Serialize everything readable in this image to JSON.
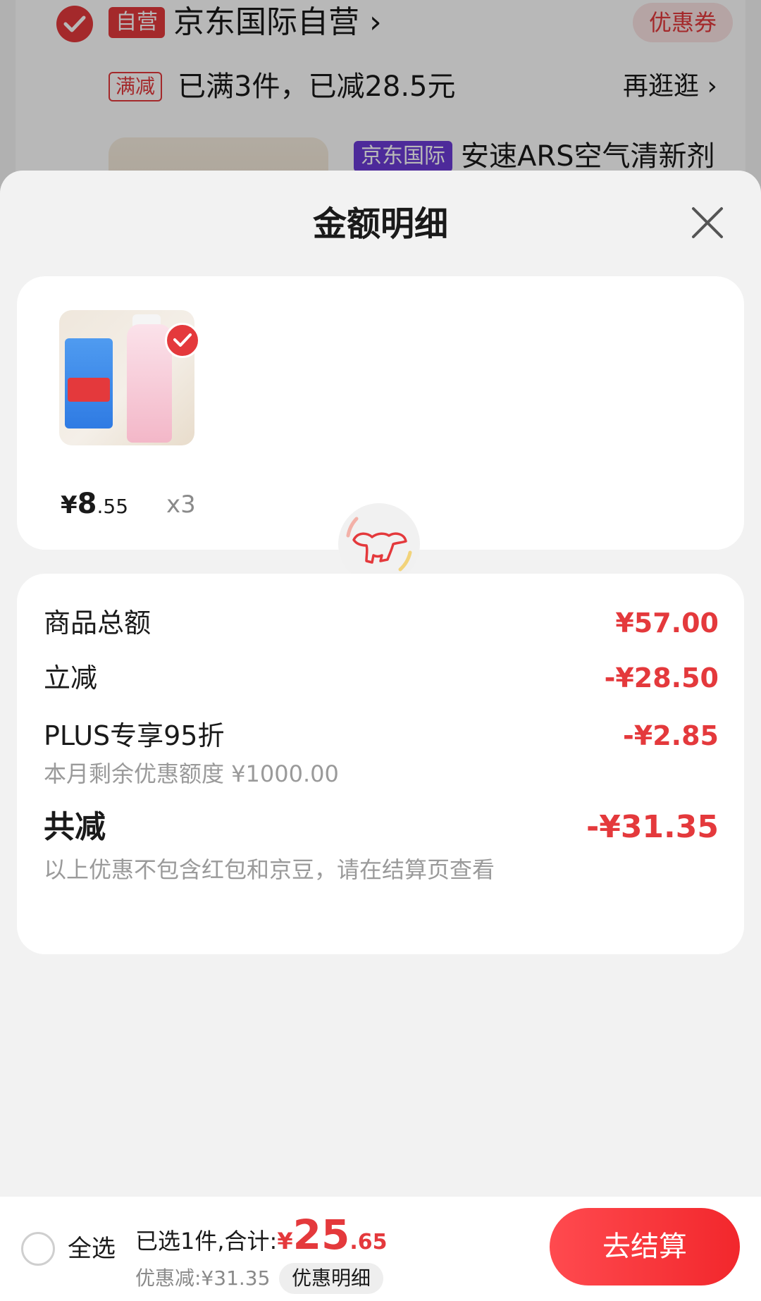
{
  "background": {
    "store_tag": "自营",
    "store_name": "京东国际自营",
    "store_chevron": "›",
    "coupon_label": "优惠券",
    "promo_tag": "满减",
    "promo_text": "已满3件，已减28.5元",
    "more_link": "再逛逛 ›",
    "product_tag": "京东国际",
    "product_title": "安速ARS空气清新剂"
  },
  "sheet": {
    "title": "金额明细",
    "product": {
      "price_currency": "¥",
      "price_int": "8",
      "price_dec": ".55",
      "quantity": "x3"
    },
    "summary": {
      "goods_total_label": "商品总额",
      "goods_total_value": "¥57.00",
      "instant_off_label": "立减",
      "instant_off_value": "-¥28.50",
      "plus_label": "PLUS专享95折",
      "plus_value": "-¥2.85",
      "plus_sub": "本月剩余优惠额度 ¥1000.00",
      "total_off_label": "共减",
      "total_off_value": "-¥31.35",
      "total_off_note": "以上优惠不包含红包和京豆，请在结算页查看"
    }
  },
  "bottom_bar": {
    "select_all_label": "全选",
    "selected_text": "已选1件,合计:",
    "total_currency": "¥",
    "total_int": "25",
    "total_dec": ".65",
    "discount_text": "优惠减:¥31.35",
    "detail_label": "优惠明细",
    "checkout_label": "去结算"
  },
  "colors": {
    "accent": "#e4393c",
    "jd_international": "#6b3bd6"
  }
}
